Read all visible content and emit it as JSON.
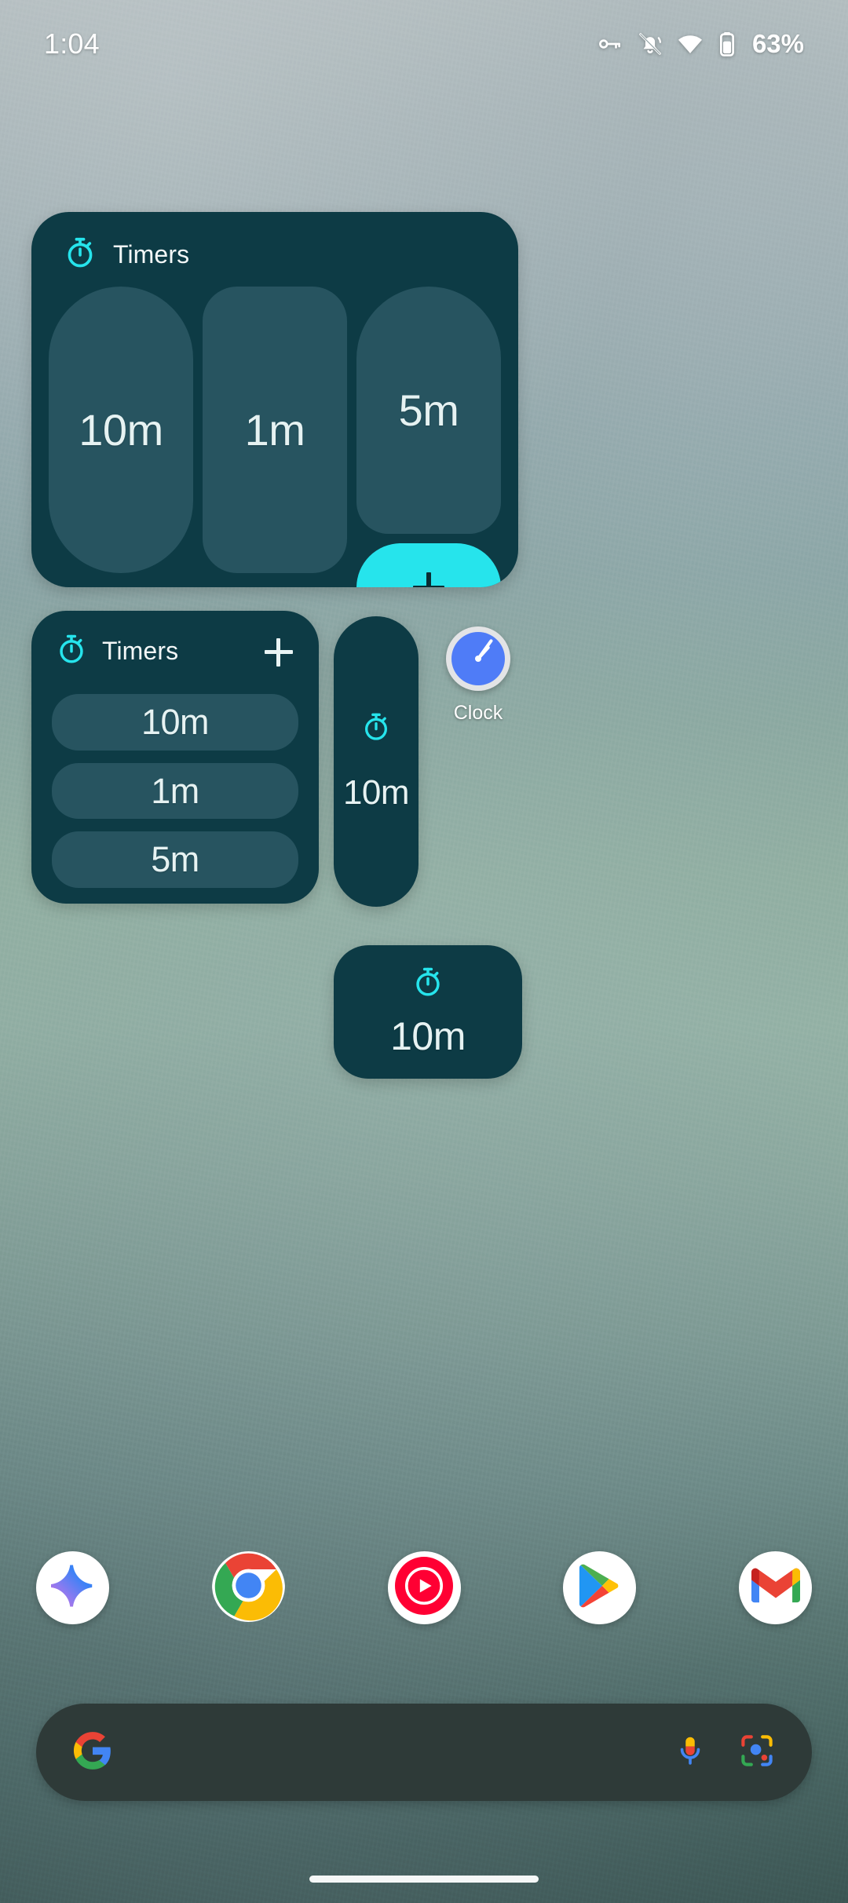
{
  "status_bar": {
    "time": "1:04",
    "battery_percent": "63%",
    "icons": [
      "vpn-key-icon",
      "ringer-vibrate-off-icon",
      "wifi-icon",
      "battery-icon"
    ]
  },
  "colors": {
    "widget_background": "#0d3b45",
    "widget_pill": "#275460",
    "accent_cyan": "#26e4ec",
    "timer_text": "#e6f2f2",
    "search_bar": "#2e3a38"
  },
  "widgets": {
    "timers_large": {
      "title": "Timers",
      "icon": "stopwatch-icon",
      "cells": [
        {
          "label": "10m"
        },
        {
          "label": "1m"
        },
        {
          "label": "5m"
        }
      ],
      "add_button": "+"
    },
    "timers_list": {
      "title": "Timers",
      "icon": "stopwatch-icon",
      "add_button": "+",
      "rows": [
        {
          "label": "10m"
        },
        {
          "label": "1m"
        },
        {
          "label": "5m"
        }
      ]
    },
    "timer_narrow": {
      "icon": "stopwatch-icon",
      "label": "10m"
    },
    "timer_wide": {
      "icon": "stopwatch-icon",
      "label": "10m"
    }
  },
  "app_clock": {
    "label": "Clock",
    "icon": "clock-icon"
  },
  "dock": {
    "apps": [
      {
        "name": "Gemini",
        "icon": "gemini-sparkle-icon"
      },
      {
        "name": "Chrome",
        "icon": "chrome-icon"
      },
      {
        "name": "YouTube Music",
        "icon": "youtube-music-icon"
      },
      {
        "name": "Play Store",
        "icon": "play-store-icon"
      },
      {
        "name": "Gmail",
        "icon": "gmail-icon"
      }
    ]
  },
  "search": {
    "placeholder": "",
    "value": "",
    "logo": "google-g-icon",
    "mic": "microphone-icon",
    "lens": "google-lens-icon"
  }
}
